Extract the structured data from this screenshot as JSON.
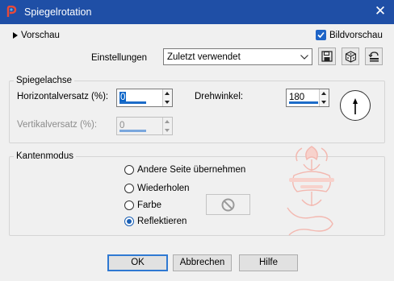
{
  "window": {
    "title": "Spiegelrotation"
  },
  "header": {
    "preview_toggle": "Vorschau",
    "image_preview_label": "Bildvorschau",
    "image_preview_checked": true,
    "settings_label": "Einstellungen",
    "settings_value": "Zuletzt verwendet"
  },
  "mirror_axis": {
    "title": "Spiegelachse",
    "horizontal_label": "Horizontalversatz (%):",
    "horizontal_value": "0",
    "vertical_label": "Vertikalversatz (%):",
    "vertical_value": "0",
    "rotation_label": "Drehwinkel:",
    "rotation_value": "180"
  },
  "edge_mode": {
    "title": "Kantenmodus",
    "options": [
      {
        "label": "Andere Seite übernehmen",
        "selected": false
      },
      {
        "label": "Wiederholen",
        "selected": false
      },
      {
        "label": "Farbe",
        "selected": false
      },
      {
        "label": "Reflektieren",
        "selected": true
      }
    ]
  },
  "footer": {
    "ok": "OK",
    "cancel": "Abbrechen",
    "help": "Hilfe"
  },
  "colors": {
    "titlebar": "#1f4fa6",
    "accent": "#1c6cc8",
    "watermark": "#f3b8b0"
  }
}
